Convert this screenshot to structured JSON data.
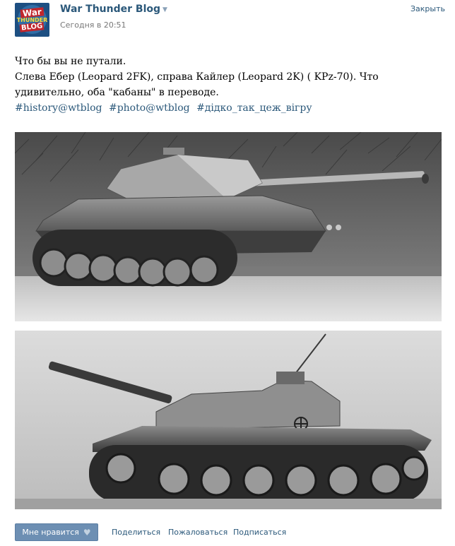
{
  "post": {
    "author": "War Thunder Blog",
    "time": "Сегодня в 20:51",
    "close_label": "Закрыть",
    "avatar": {
      "line1": "War",
      "line2": "THUNDER",
      "line3": "BLOG"
    },
    "text_line1": "Что бы вы не путали.",
    "text_line2": "Слева Ебер (Leopard 2FK), справа Кайлер (Leopard 2K) ( KPz-70). Что",
    "text_line3": "удивительно, оба \"кабаны\" в переводе.",
    "tags": [
      "#history@wtblog",
      "#photo@wtblog",
      "#дідко_так_цеж_вігру"
    ]
  },
  "photos": [
    {
      "name": "photo-ebers-tank"
    },
    {
      "name": "photo-keiler-tank"
    }
  ],
  "footer": {
    "like_label": "Мне нравится",
    "share_label": "Поделиться",
    "report_label": "Пожаловаться",
    "subscribe_label": "Подписаться"
  },
  "icons": {
    "avatar": "war-thunder-logo",
    "chevron": "chevron-down-icon",
    "like": "heart-icon"
  },
  "colors": {
    "link": "#2b587a",
    "button": "#6d8fb3",
    "time": "#777777"
  }
}
